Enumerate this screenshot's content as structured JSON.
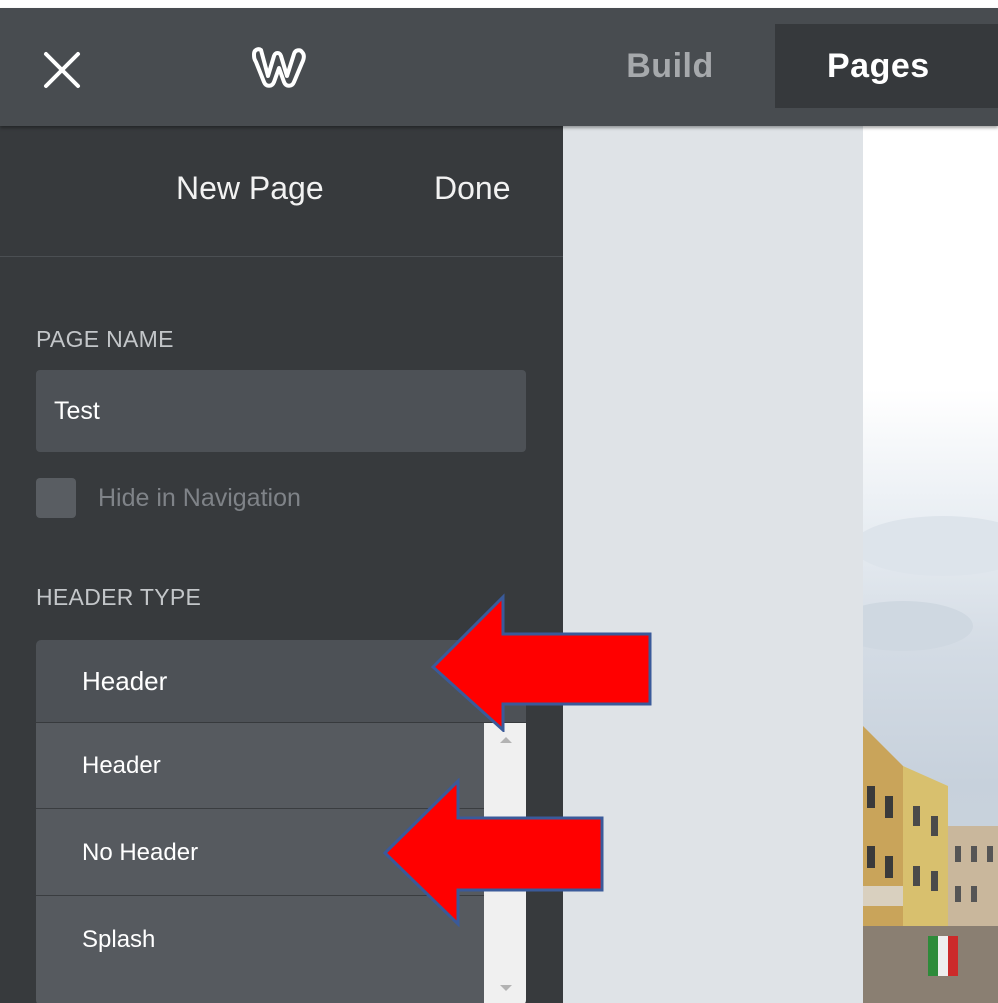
{
  "topbar": {
    "close_icon": "close-icon",
    "logo_icon": "weebly-logo",
    "tabs": [
      {
        "label": "Build",
        "active": false
      },
      {
        "label": "Pages",
        "active": true
      }
    ]
  },
  "sidebar": {
    "new_page_label": "New Page",
    "done_label": "Done",
    "page_name_label": "PAGE NAME",
    "page_name_value": "Test",
    "hide_nav_label": "Hide in Navigation",
    "hide_nav_checked": false,
    "header_type_label": "HEADER TYPE",
    "header_type_selected": "Header",
    "header_type_options": [
      "Header",
      "No Header",
      "Splash"
    ]
  },
  "annotations": {
    "arrow_color": "#ff0000",
    "arrow_outline": "#3a5a9a"
  },
  "colors": {
    "topbar_bg": "#484c50",
    "sidebar_bg": "#373a3d",
    "active_tab_bg": "#36393c",
    "preview_bg": "#dfe3e7"
  }
}
